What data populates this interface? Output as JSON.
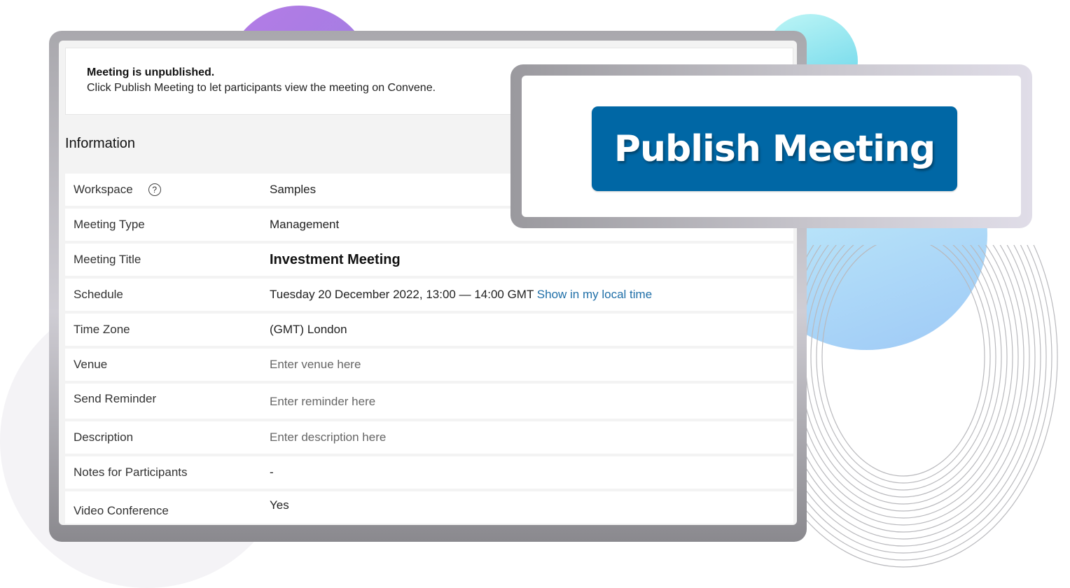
{
  "notice": {
    "title": "Meeting is unpublished.",
    "text": "Click Publish Meeting to let participants view the meeting on Convene."
  },
  "section": {
    "heading": "Information"
  },
  "fields": [
    {
      "label": "Workspace",
      "value": "Samples",
      "help_icon": "question-circle-icon"
    },
    {
      "label": "Meeting Type",
      "value": "Management"
    },
    {
      "label": "Meeting Title",
      "value": "Investment Meeting"
    },
    {
      "label": "Schedule",
      "value": "Tuesday 20 December 2022, 13:00 — 14:00 GMT",
      "link": "Show in my local time"
    },
    {
      "label": "Time Zone",
      "value": "(GMT) London"
    },
    {
      "label": "Venue",
      "placeholder": "Enter venue here"
    },
    {
      "label": "Send Reminder",
      "placeholder": "Enter reminder here"
    },
    {
      "label": "Description",
      "placeholder": "Enter description here"
    },
    {
      "label": "Notes for Participants",
      "value": "-"
    },
    {
      "label": "Video Conference",
      "value": "Yes"
    }
  ],
  "callout": {
    "button_label": "Publish Meeting"
  },
  "colors": {
    "button_blue": "#0067a5",
    "link_blue": "#1f6fa8",
    "panel_gray": "#f3f3f3"
  }
}
